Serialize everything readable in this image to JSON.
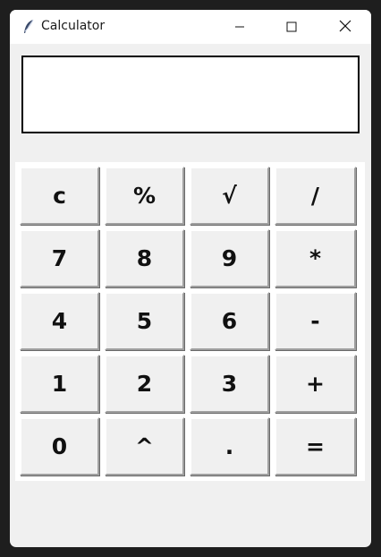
{
  "window": {
    "title": "Calculator",
    "app_icon": "feather-icon",
    "controls": [
      "minimize-icon",
      "maximize-icon",
      "close-icon"
    ]
  },
  "display": {
    "value": ""
  },
  "keys": {
    "clear": "c",
    "percent": "%",
    "sqrt": "√",
    "divide": "/",
    "seven": "7",
    "eight": "8",
    "nine": "9",
    "multiply": "*",
    "four": "4",
    "five": "5",
    "six": "6",
    "subtract": "-",
    "one": "1",
    "two": "2",
    "three": "3",
    "add": "+",
    "zero": "0",
    "power": "^",
    "decimal": ".",
    "equals": "="
  }
}
